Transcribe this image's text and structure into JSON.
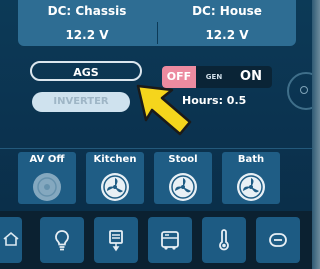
{
  "batteries": {
    "chassis": {
      "label": "DC: Chassis",
      "value": "12.2 V"
    },
    "house": {
      "label": "DC: House",
      "value": "12.2 V"
    }
  },
  "ags": {
    "label": "AGS"
  },
  "inverter": {
    "label": "INVERTER"
  },
  "generator": {
    "off_label": "OFF",
    "mode_label": "GEN",
    "on_label": "ON",
    "hours_text": "Hours: 0.5",
    "state": "off"
  },
  "fans": [
    {
      "label": "AV Off",
      "icon": "fan-icon",
      "state": "off"
    },
    {
      "label": "Kitchen",
      "icon": "fan-icon",
      "state": "on"
    },
    {
      "label": "Stool",
      "icon": "fan-icon",
      "state": "on"
    },
    {
      "label": "Bath",
      "icon": "fan-icon",
      "state": "on"
    }
  ],
  "nav": [
    {
      "icon": "home-icon"
    },
    {
      "icon": "lightbulb-icon"
    },
    {
      "icon": "tank-icon"
    },
    {
      "icon": "rv-icon"
    },
    {
      "icon": "thermometer-icon"
    },
    {
      "icon": "slide-icon"
    }
  ],
  "colors": {
    "accent": "#2e6d93",
    "off_active": "#ec8ba0",
    "arrow": "#f5d51c",
    "background": "#0b3350"
  }
}
